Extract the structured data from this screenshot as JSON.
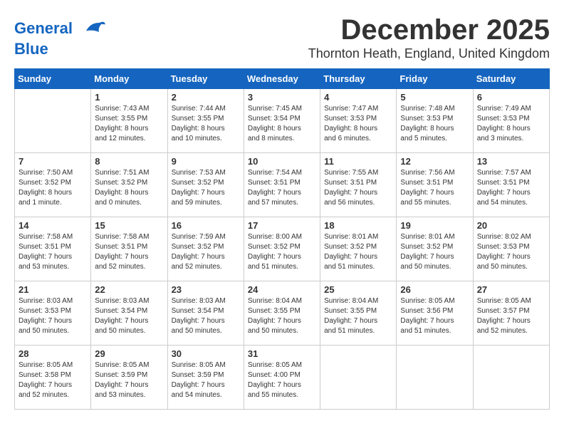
{
  "logo": {
    "line1": "General",
    "line2": "Blue"
  },
  "title": "December 2025",
  "subtitle": "Thornton Heath, England, United Kingdom",
  "days_of_week": [
    "Sunday",
    "Monday",
    "Tuesday",
    "Wednesday",
    "Thursday",
    "Friday",
    "Saturday"
  ],
  "weeks": [
    [
      {
        "day": "",
        "info": ""
      },
      {
        "day": "1",
        "info": "Sunrise: 7:43 AM\nSunset: 3:55 PM\nDaylight: 8 hours\nand 12 minutes."
      },
      {
        "day": "2",
        "info": "Sunrise: 7:44 AM\nSunset: 3:55 PM\nDaylight: 8 hours\nand 10 minutes."
      },
      {
        "day": "3",
        "info": "Sunrise: 7:45 AM\nSunset: 3:54 PM\nDaylight: 8 hours\nand 8 minutes."
      },
      {
        "day": "4",
        "info": "Sunrise: 7:47 AM\nSunset: 3:53 PM\nDaylight: 8 hours\nand 6 minutes."
      },
      {
        "day": "5",
        "info": "Sunrise: 7:48 AM\nSunset: 3:53 PM\nDaylight: 8 hours\nand 5 minutes."
      },
      {
        "day": "6",
        "info": "Sunrise: 7:49 AM\nSunset: 3:53 PM\nDaylight: 8 hours\nand 3 minutes."
      }
    ],
    [
      {
        "day": "7",
        "info": "Sunrise: 7:50 AM\nSunset: 3:52 PM\nDaylight: 8 hours\nand 1 minute."
      },
      {
        "day": "8",
        "info": "Sunrise: 7:51 AM\nSunset: 3:52 PM\nDaylight: 8 hours\nand 0 minutes."
      },
      {
        "day": "9",
        "info": "Sunrise: 7:53 AM\nSunset: 3:52 PM\nDaylight: 7 hours\nand 59 minutes."
      },
      {
        "day": "10",
        "info": "Sunrise: 7:54 AM\nSunset: 3:51 PM\nDaylight: 7 hours\nand 57 minutes."
      },
      {
        "day": "11",
        "info": "Sunrise: 7:55 AM\nSunset: 3:51 PM\nDaylight: 7 hours\nand 56 minutes."
      },
      {
        "day": "12",
        "info": "Sunrise: 7:56 AM\nSunset: 3:51 PM\nDaylight: 7 hours\nand 55 minutes."
      },
      {
        "day": "13",
        "info": "Sunrise: 7:57 AM\nSunset: 3:51 PM\nDaylight: 7 hours\nand 54 minutes."
      }
    ],
    [
      {
        "day": "14",
        "info": "Sunrise: 7:58 AM\nSunset: 3:51 PM\nDaylight: 7 hours\nand 53 minutes."
      },
      {
        "day": "15",
        "info": "Sunrise: 7:58 AM\nSunset: 3:51 PM\nDaylight: 7 hours\nand 52 minutes."
      },
      {
        "day": "16",
        "info": "Sunrise: 7:59 AM\nSunset: 3:52 PM\nDaylight: 7 hours\nand 52 minutes."
      },
      {
        "day": "17",
        "info": "Sunrise: 8:00 AM\nSunset: 3:52 PM\nDaylight: 7 hours\nand 51 minutes."
      },
      {
        "day": "18",
        "info": "Sunrise: 8:01 AM\nSunset: 3:52 PM\nDaylight: 7 hours\nand 51 minutes."
      },
      {
        "day": "19",
        "info": "Sunrise: 8:01 AM\nSunset: 3:52 PM\nDaylight: 7 hours\nand 50 minutes."
      },
      {
        "day": "20",
        "info": "Sunrise: 8:02 AM\nSunset: 3:53 PM\nDaylight: 7 hours\nand 50 minutes."
      }
    ],
    [
      {
        "day": "21",
        "info": "Sunrise: 8:03 AM\nSunset: 3:53 PM\nDaylight: 7 hours\nand 50 minutes."
      },
      {
        "day": "22",
        "info": "Sunrise: 8:03 AM\nSunset: 3:54 PM\nDaylight: 7 hours\nand 50 minutes."
      },
      {
        "day": "23",
        "info": "Sunrise: 8:03 AM\nSunset: 3:54 PM\nDaylight: 7 hours\nand 50 minutes."
      },
      {
        "day": "24",
        "info": "Sunrise: 8:04 AM\nSunset: 3:55 PM\nDaylight: 7 hours\nand 50 minutes."
      },
      {
        "day": "25",
        "info": "Sunrise: 8:04 AM\nSunset: 3:55 PM\nDaylight: 7 hours\nand 51 minutes."
      },
      {
        "day": "26",
        "info": "Sunrise: 8:05 AM\nSunset: 3:56 PM\nDaylight: 7 hours\nand 51 minutes."
      },
      {
        "day": "27",
        "info": "Sunrise: 8:05 AM\nSunset: 3:57 PM\nDaylight: 7 hours\nand 52 minutes."
      }
    ],
    [
      {
        "day": "28",
        "info": "Sunrise: 8:05 AM\nSunset: 3:58 PM\nDaylight: 7 hours\nand 52 minutes."
      },
      {
        "day": "29",
        "info": "Sunrise: 8:05 AM\nSunset: 3:59 PM\nDaylight: 7 hours\nand 53 minutes."
      },
      {
        "day": "30",
        "info": "Sunrise: 8:05 AM\nSunset: 3:59 PM\nDaylight: 7 hours\nand 54 minutes."
      },
      {
        "day": "31",
        "info": "Sunrise: 8:05 AM\nSunset: 4:00 PM\nDaylight: 7 hours\nand 55 minutes."
      },
      {
        "day": "",
        "info": ""
      },
      {
        "day": "",
        "info": ""
      },
      {
        "day": "",
        "info": ""
      }
    ]
  ]
}
